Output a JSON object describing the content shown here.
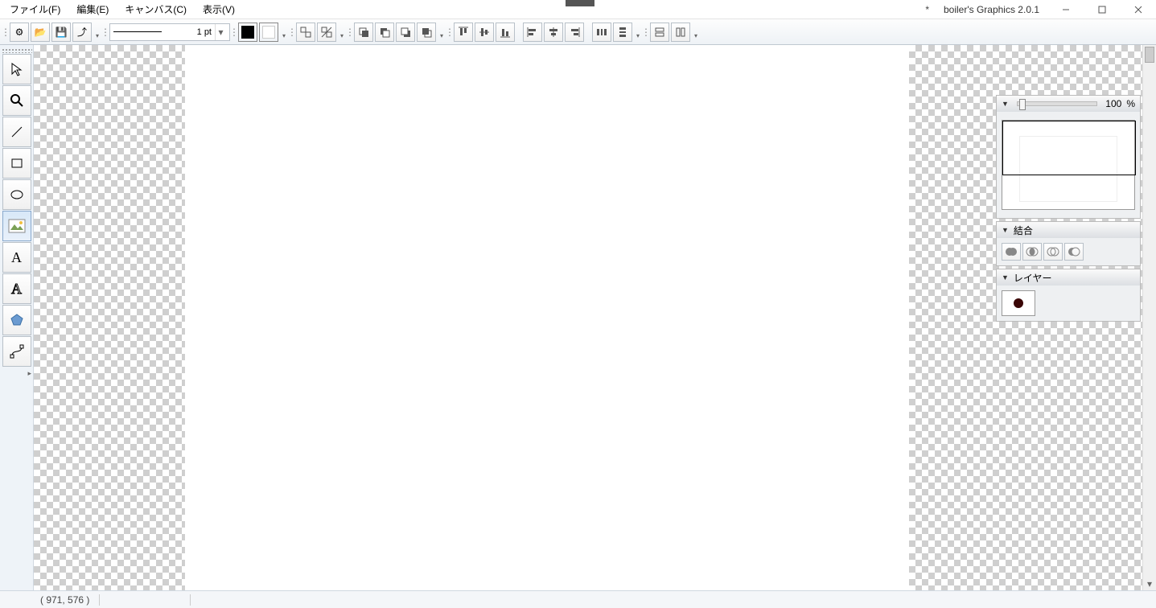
{
  "app": {
    "title": "boiler's Graphics 2.0.1",
    "modified": "*"
  },
  "menu": {
    "file": "ファイル(F)",
    "edit": "編集(E)",
    "canvas": "キャンバス(C)",
    "view": "表示(V)"
  },
  "toolbar": {
    "stroke_label": "1 pt",
    "fill_color": "#000000",
    "bg_color": "#ffffff"
  },
  "zoom": {
    "percent": "100",
    "unit": "%"
  },
  "panels": {
    "combine": "結合",
    "layers": "レイヤー"
  },
  "status": {
    "coord": "( 971,    576 )"
  },
  "tools": [
    "select",
    "zoom",
    "line",
    "rect",
    "ellipse",
    "image",
    "text",
    "text-outline",
    "polygon",
    "bezier"
  ],
  "selected_tool": "image",
  "chart_data": null
}
